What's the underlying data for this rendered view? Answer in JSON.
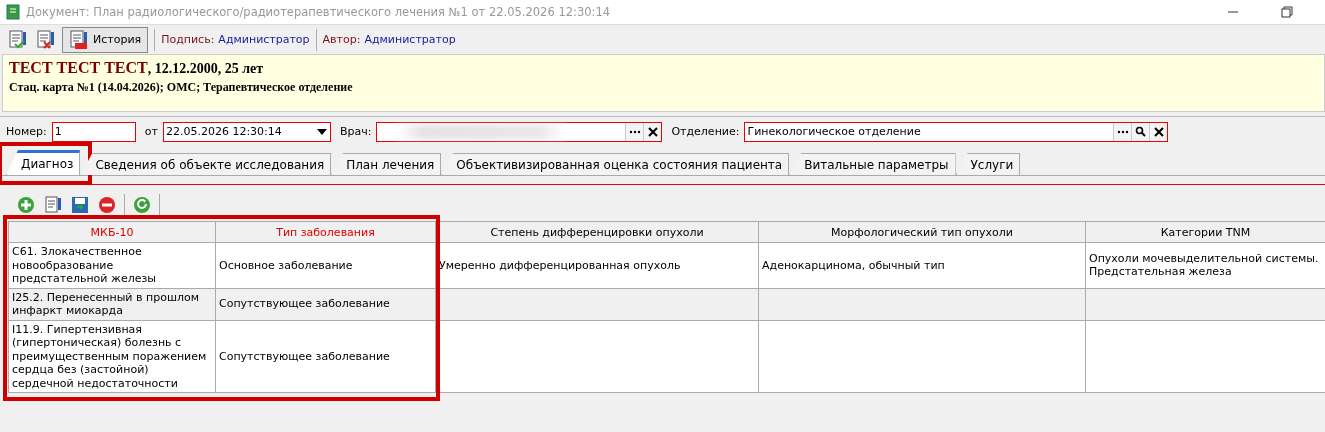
{
  "window": {
    "title": "Документ: План радиологического/радиотерапевтического лечения №1 от 22.05.2026 12:30:14"
  },
  "toolbar": {
    "history_button": "История",
    "signature_label": "Подпись:",
    "signature_value": "Администратор",
    "author_label": "Автор:",
    "author_value": "Администратор"
  },
  "patient": {
    "name": "ТЕСТ ТЕСТ ТЕСТ",
    "details": ", 12.12.2000, 25 лет",
    "card": "Стац. карта №1 (14.04.2026); ОМС; Терапевтическое отделение"
  },
  "form": {
    "number_label": "Номер:",
    "number_value": "1",
    "date_label": "от",
    "date_value": "22.05.2026 12:30:14",
    "doctor_label": "Врач:",
    "department_label": "Отделение:",
    "department_value": "Гинекологическое отделение"
  },
  "tabs": [
    {
      "label": "Диагноз",
      "selected": true,
      "highlighted": true
    },
    {
      "label": "Сведения об объекте исследования",
      "selected": false,
      "highlighted": false
    },
    {
      "label": "План лечения",
      "selected": false,
      "highlighted": false
    },
    {
      "label": "Объективизированная оценка состояния пациента",
      "selected": false,
      "highlighted": false
    },
    {
      "label": "Витальные параметры",
      "selected": false,
      "highlighted": false
    },
    {
      "label": "Услуги",
      "selected": false,
      "highlighted": false
    }
  ],
  "table": {
    "columns": [
      {
        "title": "МКБ-10",
        "required": true,
        "highlighted": true
      },
      {
        "title": "Тип заболевания",
        "required": true,
        "highlighted": true
      },
      {
        "title": "Степень дифференцировки опухоли",
        "required": false
      },
      {
        "title": "Морфологический тип опухоли",
        "required": false
      },
      {
        "title": "Категории TNM",
        "required": false
      }
    ],
    "rows": [
      [
        "C61. Злокачественное новообразование предстательной железы",
        "Основное заболевание",
        "Умеренно дифференцированная опухоль",
        "Аденокарцинома, обычный тип",
        "Опухоли мочевыделительной системы. Предстательная железа"
      ],
      [
        "I25.2. Перенесенный в прошлом инфаркт миокарда",
        "Сопутствующее заболевание",
        "",
        "",
        ""
      ],
      [
        "I11.9. Гипертензивная (гипертоническая) болезнь с преимущественным поражением сердца без (застойной) сердечной недостаточности",
        "Сопутствующее заболевание",
        "",
        "",
        ""
      ]
    ]
  }
}
